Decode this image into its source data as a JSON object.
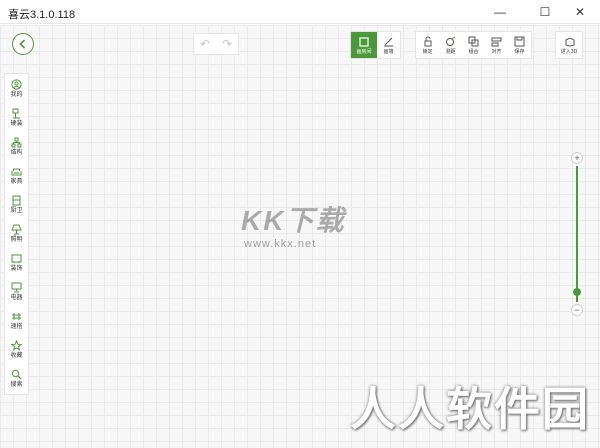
{
  "window": {
    "title": "喜云3.1.0.118",
    "minimize": "—",
    "maximize": "☐",
    "close": "✕"
  },
  "toolbar": {
    "undo": "↶",
    "redo": "↷",
    "room_tools": [
      {
        "label": "画房间",
        "icon": "square-icon",
        "active": true
      },
      {
        "label": "画墙",
        "icon": "pen-icon",
        "active": false
      }
    ],
    "edit_tools": [
      {
        "label": "锁定",
        "icon": "lock-icon"
      },
      {
        "label": "测距",
        "icon": "measure-icon"
      },
      {
        "label": "组合",
        "icon": "group-icon"
      },
      {
        "label": "对齐",
        "icon": "align-icon"
      },
      {
        "label": "保存",
        "icon": "save-icon"
      }
    ],
    "view_3d_label": "进入3D"
  },
  "sidebar": {
    "items": [
      {
        "label": "我的",
        "icon": "user-icon"
      },
      {
        "label": "硬装",
        "icon": "hard-decor-icon"
      },
      {
        "label": "结构",
        "icon": "structure-icon"
      },
      {
        "label": "家具",
        "icon": "sofa-icon"
      },
      {
        "label": "厨卫",
        "icon": "kitchen-icon"
      },
      {
        "label": "照明",
        "icon": "lamp-icon"
      },
      {
        "label": "装饰",
        "icon": "frame-icon"
      },
      {
        "label": "电器",
        "icon": "monitor-icon"
      },
      {
        "label": "速搭",
        "icon": "quick-build-icon"
      },
      {
        "label": "收藏",
        "icon": "star-icon"
      },
      {
        "label": "搜索",
        "icon": "search-icon"
      }
    ]
  },
  "zoom": {
    "in": "+",
    "out": "−",
    "level": 0.07
  },
  "watermark": {
    "text": "KK下载",
    "url": "www.kkx.net"
  },
  "overlay": {
    "text": "人人软件园"
  },
  "colors": {
    "accent": "#4a9a3a",
    "grid": "#e9e9e9",
    "canvas": "#f7f7f7"
  }
}
